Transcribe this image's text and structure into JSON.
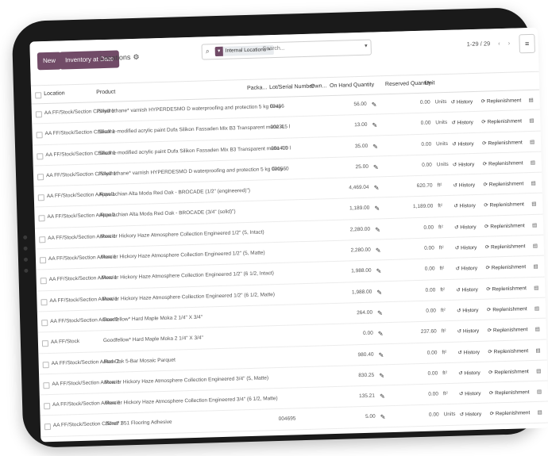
{
  "control": {
    "new_label": "New",
    "inventory_label": "Inventory at Date",
    "breadcrumb": "Locations",
    "search_facet": "Internal Locations",
    "search_placeholder": "Search...",
    "pager": "1-29 / 29"
  },
  "columns": {
    "location": "Location",
    "product": "Product",
    "package": "Packa...",
    "lot": "Lot/Serial Number",
    "owner": "Own...",
    "on_hand": "On Hand Quantity",
    "reserved": "Reserved Quantity",
    "unit": "Unit"
  },
  "actions": {
    "history": "History",
    "replenishment": "Replenishment"
  },
  "rows": [
    {
      "location": "AA FF/Stock/Section C/Shelf 1",
      "product": "Polyurethane* varnish HYPERDESMO D waterproofing and protection 5 kg Gray",
      "lot": "00456",
      "qty": "56.00",
      "reserved": "0.00",
      "unit": "Units"
    },
    {
      "location": "AA FF/Stock/Section C/Shelf 1",
      "product": "Silicone-modified acrylic paint Dufa Silikon Fassaden Mix B3 Transparent matte 4.5 l",
      "lot": "00231",
      "qty": "13.00",
      "reserved": "0.00",
      "unit": "Units"
    },
    {
      "location": "AA FF/Stock/Section C/Shelf 1",
      "product": "Silicone-modified acrylic paint Dufa Silikon Fassaden Mix B3 Transparent matte 4.5 l",
      "lot": "001400",
      "qty": "35.00",
      "reserved": "0.00",
      "unit": "Units"
    },
    {
      "location": "AA FF/Stock/Section C/Shelf 1",
      "product": "Polyurethane* varnish HYPERDESMO D waterproofing and protection 5 kg Gray",
      "lot": "000560",
      "qty": "25.00",
      "reserved": "0.00",
      "unit": "Units"
    },
    {
      "location": "AA FF/Stock/Section A/Row 1",
      "product": "Appalachian Alta Moda Red Oak - BROCADE (1/2\" (engineered)\")",
      "lot": "",
      "qty": "4,469.04",
      "reserved": "620.70",
      "unit": "ft²"
    },
    {
      "location": "AA FF/Stock/Section A/Row 1",
      "product": "Appalachian Alta Moda Red Oak - BROCADE (3/4\" (solid)\")",
      "lot": "",
      "qty": "1,189.00",
      "reserved": "1,189.00",
      "unit": "ft²"
    },
    {
      "location": "AA FF/Stock/Section A/Row 1",
      "product": "Mercier Hickory Haze Atmosphere Collection Engineered 1/2\" (5, Intact)",
      "lot": "",
      "qty": "2,280.00",
      "reserved": "0.00",
      "unit": "ft²"
    },
    {
      "location": "AA FF/Stock/Section A/Row 1",
      "product": "Mercier Hickory Haze Atmosphere Collection Engineered 1/2\" (5, Matte)",
      "lot": "",
      "qty": "2,280.00",
      "reserved": "0.00",
      "unit": "ft²"
    },
    {
      "location": "AA FF/Stock/Section A/Row 1",
      "product": "Mercier Hickory Haze Atmosphere Collection Engineered 1/2\" (6 1/2, Intact)",
      "lot": "",
      "qty": "1,988.00",
      "reserved": "0.00",
      "unit": "ft²"
    },
    {
      "location": "AA FF/Stock/Section A/Row 1",
      "product": "Mercier Hickory Haze Atmosphere Collection Engineered 1/2\" (6 1/2, Matte)",
      "lot": "",
      "qty": "1,988.00",
      "reserved": "0.00",
      "unit": "ft²"
    },
    {
      "location": "AA FF/Stock/Section A/Row 2",
      "product": "Goodfellow* Hard Maple Moka 2 1/4\" X 3/4\"",
      "lot": "",
      "qty": "264.00",
      "reserved": "0.00",
      "unit": "ft²"
    },
    {
      "location": "AA FF/Stock",
      "product": "Goodfellow* Hard Maple Moka 2 1/4\" X 3/4\"",
      "lot": "",
      "qty": "0.00",
      "reserved": "237.60",
      "unit": "ft²"
    },
    {
      "location": "AA FF/Stock/Section A/Row 2",
      "product": "Red Oak 5-Bar Mosaic Parquet",
      "lot": "",
      "qty": "980.40",
      "reserved": "0.00",
      "unit": "ft²"
    },
    {
      "location": "AA FF/Stock/Section A/Row 1",
      "product": "Mercier Hickory Haze Atmosphere Collection Engineered 3/4\" (5, Matte)",
      "lot": "",
      "qty": "830.25",
      "reserved": "0.00",
      "unit": "ft²"
    },
    {
      "location": "AA FF/Stock/Section A/Row 1",
      "product": "Mercier Hickory Haze Atmosphere Collection Engineered 3/4\" (6 1/2, Matte)",
      "lot": "",
      "qty": "135.21",
      "reserved": "0.00",
      "unit": "ft²"
    },
    {
      "location": "AA FF/Stock/Section C/Shelf 1",
      "product": "Bona* 851 Flooring Adhesive",
      "lot": "004695",
      "qty": "5.00",
      "reserved": "0.00",
      "unit": "Units"
    }
  ]
}
